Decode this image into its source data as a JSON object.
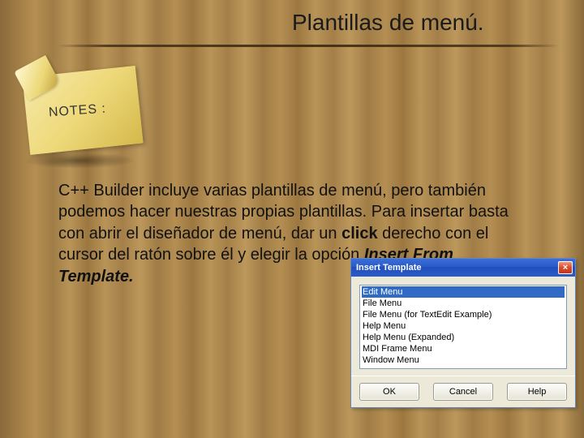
{
  "slide": {
    "title": "Plantillas de menú.",
    "note_label": "NOTES :",
    "body_html": "C++ Builder incluye varias plantillas de menú, pero también podemos hacer nuestras propias plantillas. Para insertar basta con abrir el diseñador de menú, dar un <b>click</b> derecho con el cursor del ratón sobre él y elegir la opción <b><i>Insert From Template.</i></b>"
  },
  "dialog": {
    "title": "Insert Template",
    "close_glyph": "×",
    "items": [
      "Edit Menu",
      "File Menu",
      "File Menu (for TextEdit Example)",
      "Help Menu",
      "Help Menu (Expanded)",
      "MDI Frame Menu",
      "Window Menu"
    ],
    "selected_index": 0,
    "buttons": {
      "ok": "OK",
      "cancel": "Cancel",
      "help": "Help"
    }
  }
}
